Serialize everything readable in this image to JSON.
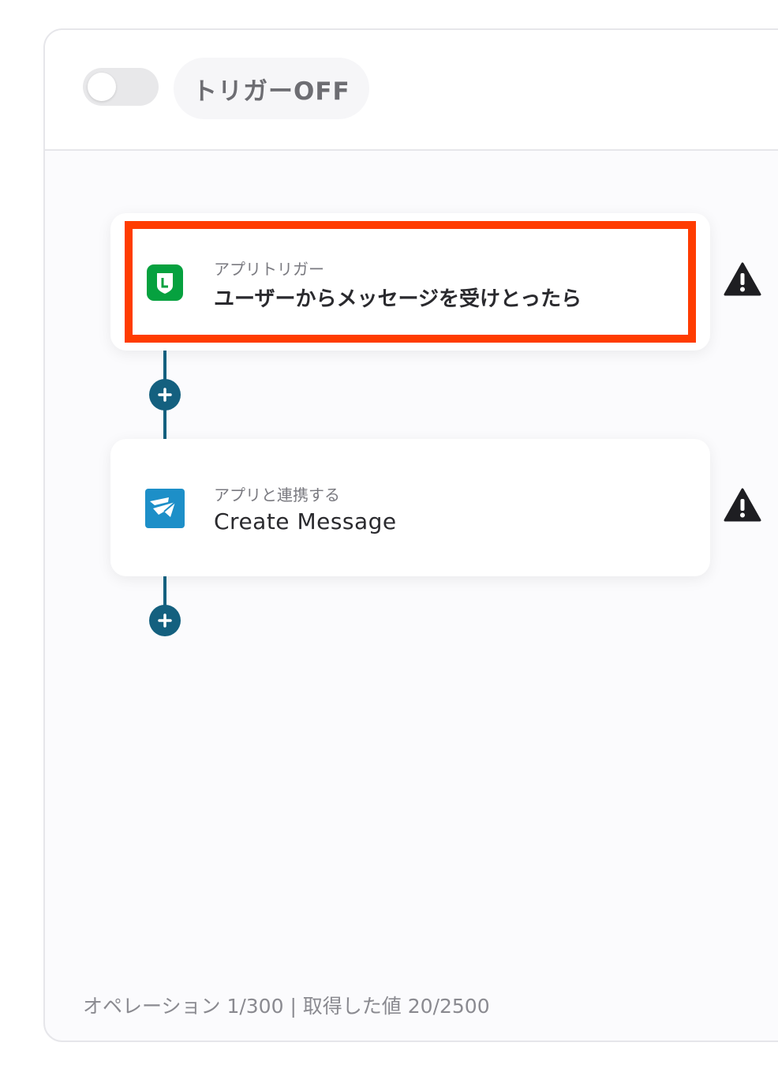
{
  "header": {
    "toggle_state": "off",
    "trigger_status_label": "トリガーOFF"
  },
  "steps": [
    {
      "app_icon": "line-app-icon",
      "subtitle": "アプリトリガー",
      "title": "ユーザーからメッセージを受けとったら",
      "highlighted": true,
      "warning_icon": "warning-icon"
    },
    {
      "app_icon": "app-logo-icon",
      "subtitle": "アプリと連携する",
      "title": "Create Message",
      "highlighted": false,
      "warning_icon": "warning-icon"
    }
  ],
  "add_step_icon": "plus-icon",
  "footer": {
    "usage_text": "オペレーション 1/300 | 取得した値 20/2500"
  },
  "colors": {
    "highlight": "#ff3c00",
    "connector": "#14607f",
    "line_green": "#06a13f",
    "app_blue": "#1d8fc8"
  }
}
